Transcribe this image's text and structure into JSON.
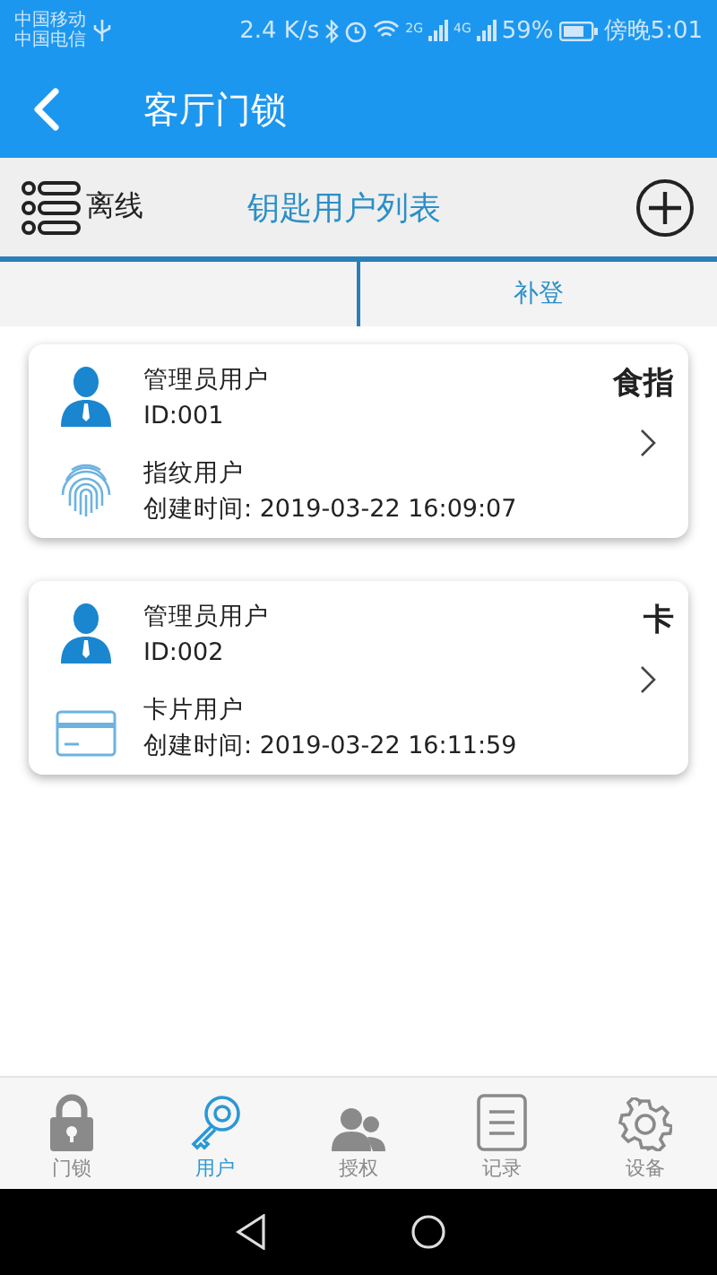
{
  "status_bar": {
    "carriers": [
      "中国移动",
      "中国电信"
    ],
    "speed": "2.4 K/s",
    "net_1": "2G",
    "net_2": "4G",
    "battery": "59%",
    "time": "傍晚5:01"
  },
  "header": {
    "title": "客厅门锁"
  },
  "toolbar": {
    "status": "离线",
    "title": "钥匙用户列表"
  },
  "segments": {
    "right_label": "补登"
  },
  "users": [
    {
      "role": "管理员用户",
      "id": "ID:001",
      "kind": "fingerprint",
      "type_label": "指纹用户",
      "created": "创建时间: 2019-03-22 16:09:07",
      "tag": "食指"
    },
    {
      "role": "管理员用户",
      "id": "ID:002",
      "kind": "card",
      "type_label": "卡片用户",
      "created": "创建时间: 2019-03-22 16:11:59",
      "tag": "卡"
    }
  ],
  "tabs": [
    {
      "kind": "lock",
      "label": "门锁",
      "selected": false
    },
    {
      "kind": "key",
      "label": "用户",
      "selected": true
    },
    {
      "kind": "people",
      "label": "授权",
      "selected": false
    },
    {
      "kind": "list",
      "label": "记录",
      "selected": false
    },
    {
      "kind": "gear",
      "label": "设备",
      "selected": false
    }
  ]
}
